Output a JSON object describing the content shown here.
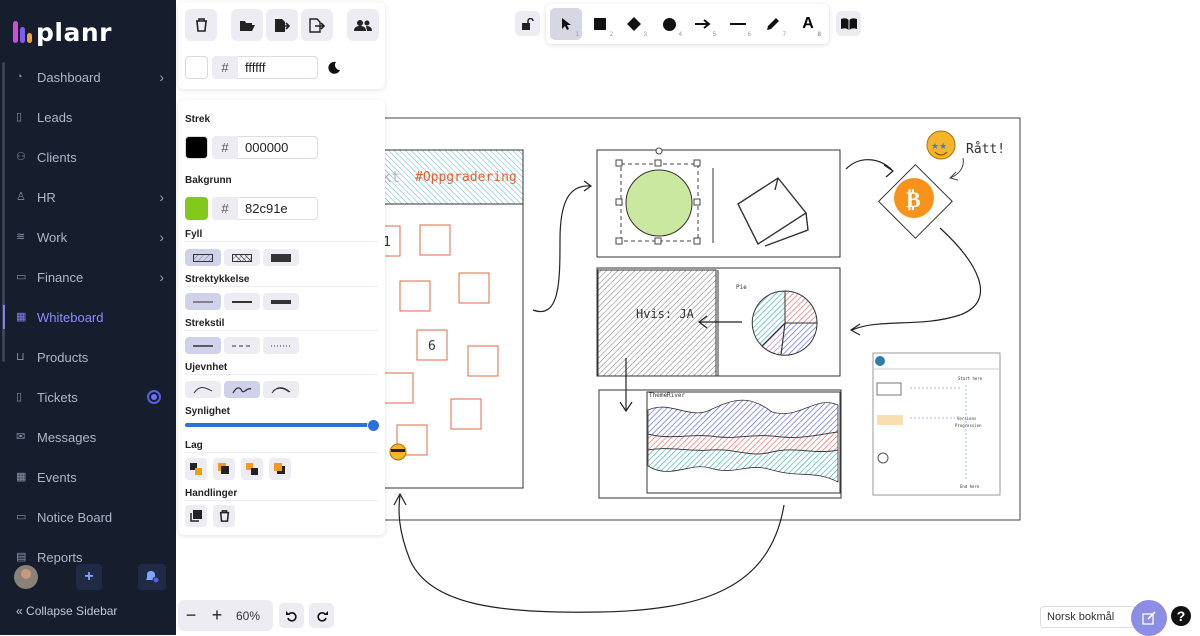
{
  "brand": {
    "name": "planr",
    "bar_colors": [
      "#d04bd8",
      "#7b5ff2",
      "#f2a13a"
    ]
  },
  "sidebar": {
    "items": [
      {
        "label": "Dashboard",
        "icon": "dashboard-icon",
        "chevron": true
      },
      {
        "label": "Leads",
        "icon": "file-icon",
        "chevron": false
      },
      {
        "label": "Clients",
        "icon": "users-icon",
        "chevron": false
      },
      {
        "label": "HR",
        "icon": "person-icon",
        "chevron": true
      },
      {
        "label": "Work",
        "icon": "layers-icon",
        "chevron": true
      },
      {
        "label": "Finance",
        "icon": "finance-icon",
        "chevron": true
      },
      {
        "label": "Whiteboard",
        "icon": "whiteboard-icon",
        "chevron": false,
        "active": true
      },
      {
        "label": "Products",
        "icon": "cart-icon",
        "chevron": false
      },
      {
        "label": "Tickets",
        "icon": "ticket-icon",
        "chevron": false,
        "badge_dot": true
      },
      {
        "label": "Messages",
        "icon": "mail-icon",
        "chevron": false
      },
      {
        "label": "Events",
        "icon": "calendar-icon",
        "chevron": false
      },
      {
        "label": "Notice Board",
        "icon": "board-icon",
        "chevron": false
      },
      {
        "label": "Reports",
        "icon": "report-icon",
        "chevron": false
      }
    ],
    "collapse_label": "Collapse Sidebar",
    "add_label": "+"
  },
  "canvas_bg": {
    "hex": "ffffff",
    "hash": "#"
  },
  "props": {
    "stroke_label": "Strek",
    "stroke_hex": "000000",
    "stroke_color": "#000000",
    "background_label": "Bakgrunn",
    "background_hex": "82c91e",
    "background_color": "#82c91e",
    "hash": "#",
    "fill_label": "Fyll",
    "stroke_width_label": "Strektykkelse",
    "stroke_style_label": "Strekstil",
    "roughness_label": "Ujevnhet",
    "opacity_label": "Synlighet",
    "opacity": 100,
    "layers_label": "Lag",
    "actions_label": "Handlinger"
  },
  "toolbar": {
    "tools": [
      {
        "name": "select-tool",
        "key": "1"
      },
      {
        "name": "rectangle-tool",
        "key": "2"
      },
      {
        "name": "diamond-tool",
        "key": "3"
      },
      {
        "name": "ellipse-tool",
        "key": "4"
      },
      {
        "name": "arrow-tool",
        "key": "5"
      },
      {
        "name": "line-tool",
        "key": "6"
      },
      {
        "name": "pencil-tool",
        "key": "7"
      },
      {
        "name": "text-tool",
        "key": "8",
        "glyph": "A"
      }
    ]
  },
  "zoom": {
    "value": "60%",
    "minus": "−",
    "plus": "+"
  },
  "language": "Norsk bokmål",
  "help": "?",
  "board": {
    "title_faded": "Prosjekt",
    "title_tag": "#Oppgradering",
    "num1": "1",
    "num6": "6",
    "ratt": "Rått!",
    "hvis": "Hvis: JA",
    "themeriver": "ThemeRiver",
    "pie_label": "Pie",
    "doc_lines": [
      "Start here",
      "Versions",
      "Progression",
      "End here"
    ]
  }
}
